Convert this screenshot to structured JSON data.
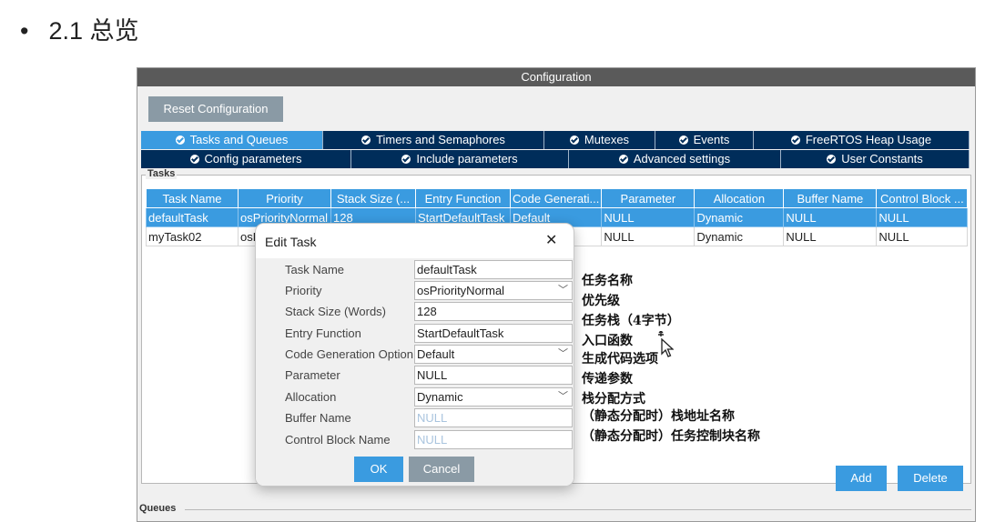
{
  "slide": {
    "bullet": "•",
    "title": "2.1 总览"
  },
  "config": {
    "title": "Configuration",
    "reset_label": "Reset Configuration",
    "tabs_row1": [
      "Tasks and Queues",
      "Timers and Semaphores",
      "Mutexes",
      "Events",
      "FreeRTOS Heap Usage"
    ],
    "tabs_row2": [
      "Config parameters",
      "Include parameters",
      "Advanced settings",
      "User Constants"
    ],
    "active_tab": "Tasks and Queues",
    "tasks_label": "Tasks",
    "queues_label": "Queues",
    "table": {
      "headers": [
        "Task Name",
        "Priority",
        "Stack Size (...",
        "Entry Function",
        "Code Generati...",
        "Parameter",
        "Allocation",
        "Buffer Name",
        "Control Block ..."
      ],
      "rows": [
        [
          "defaultTask",
          "osPriorityNormal",
          "128",
          "StartDefaultTask",
          "Default",
          "NULL",
          "Dynamic",
          "NULL",
          "NULL"
        ],
        [
          "myTask02",
          "osF",
          "",
          "",
          "",
          "NULL",
          "Dynamic",
          "NULL",
          "NULL"
        ]
      ]
    },
    "add_label": "Add",
    "delete_label": "Delete"
  },
  "dialog": {
    "title": "Edit Task",
    "close_glyph": "✕",
    "fields": [
      {
        "label": "Task Name",
        "value": "defaultTask"
      },
      {
        "label": "Priority",
        "value": "osPriorityNormal"
      },
      {
        "label": "Stack Size (Words)",
        "value": "128"
      },
      {
        "label": "Entry Function",
        "value": "StartDefaultTask"
      },
      {
        "label": "Code Generation Option",
        "value": "Default"
      },
      {
        "label": "Parameter",
        "value": "NULL"
      },
      {
        "label": "Allocation",
        "value": "Dynamic"
      },
      {
        "label": "Buffer Name",
        "value": "NULL"
      },
      {
        "label": "Control Block Name",
        "value": "NULL"
      }
    ],
    "ok_label": "OK",
    "cancel_label": "Cancel",
    "dropdown_glyph": "﹀"
  },
  "annotations": [
    "任务名称",
    "优先级",
    "任务栈（4字节）",
    "入口函数",
    "生成代码选项",
    "传递参数",
    "栈分配方式",
    "（静态分配时）栈地址名称",
    "（静态分配时）任务控制块名称"
  ],
  "colors": {
    "accent": "#3a9be0",
    "tab_dark": "#002d5a",
    "gray_button": "#8a9aa5"
  }
}
